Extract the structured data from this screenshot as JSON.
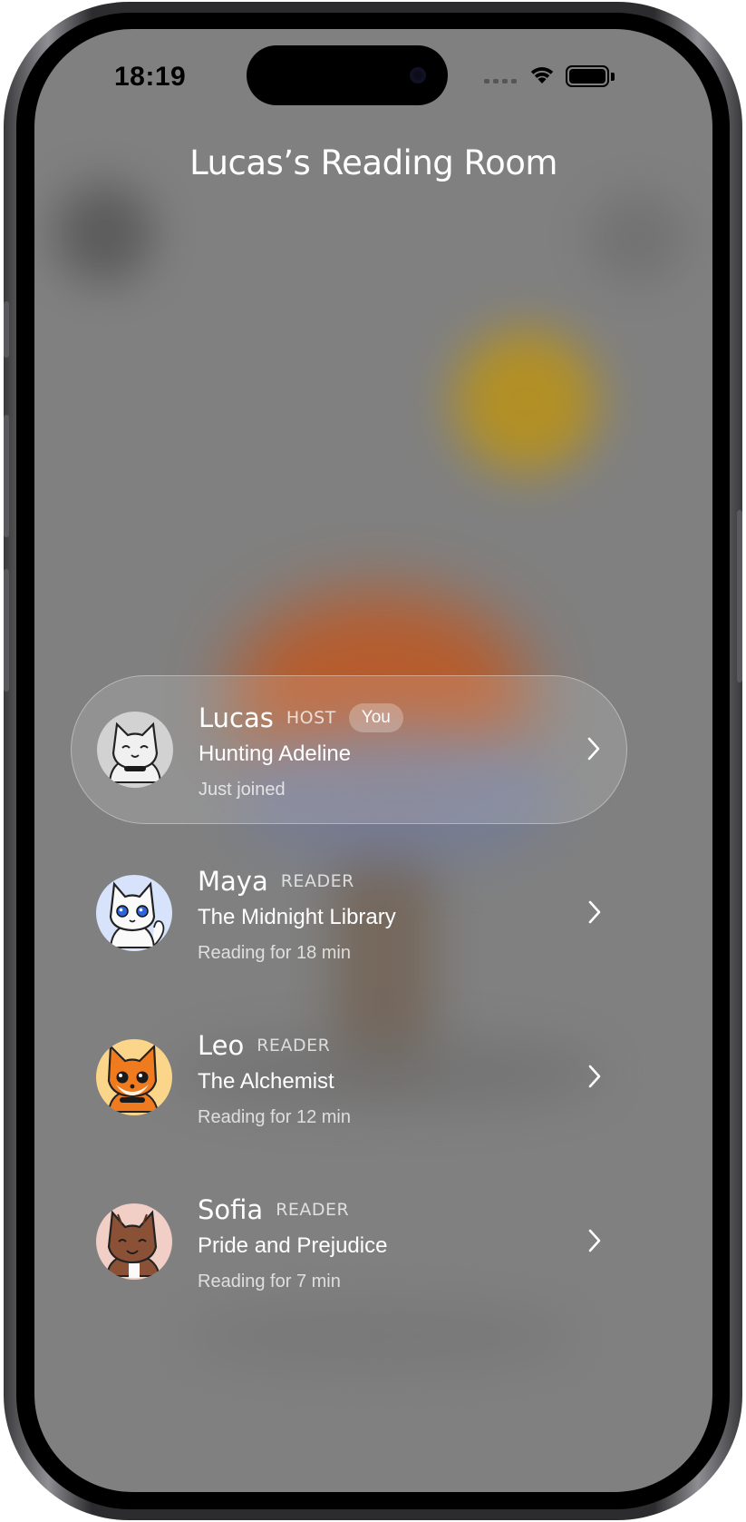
{
  "status_bar": {
    "time": "18:19"
  },
  "room": {
    "title": "Lucas’s Reading Room"
  },
  "readers": [
    {
      "name": "Lucas",
      "role": "HOST",
      "badge": "You",
      "book": "Hunting Adeline",
      "status": "Just joined",
      "avatar": "gray-cat-avatar"
    },
    {
      "name": "Maya",
      "role": "READER",
      "book": "The Midnight Library",
      "status": "Reading for 18 min",
      "avatar": "white-cat-avatar"
    },
    {
      "name": "Leo",
      "role": "READER",
      "book": "The Alchemist",
      "status": "Reading for 12 min",
      "avatar": "orange-fox-avatar"
    },
    {
      "name": "Sofia",
      "role": "READER",
      "book": "Pride and Prejudice",
      "status": "Reading for 7 min",
      "avatar": "brown-cat-avatar"
    }
  ],
  "colors": {
    "screen_background": "#808080",
    "text": "#ffffff"
  }
}
